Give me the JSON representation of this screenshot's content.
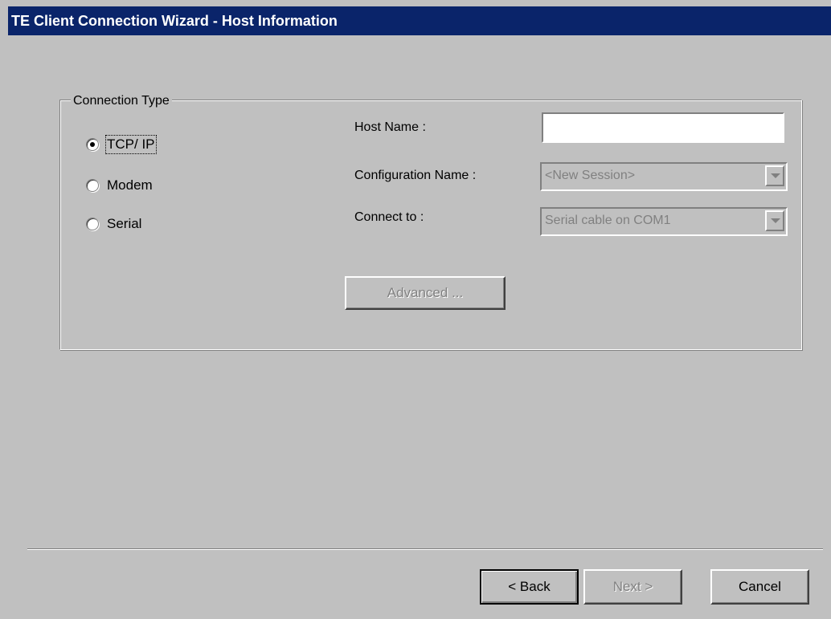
{
  "window": {
    "title": "TE Client Connection Wizard - Host Information"
  },
  "connection_type": {
    "legend": "Connection Type",
    "options": [
      {
        "label": "TCP/ IP",
        "selected": true
      },
      {
        "label": "Modem",
        "selected": false
      },
      {
        "label": "Serial",
        "selected": false
      }
    ]
  },
  "fields": {
    "host_name": {
      "label": "Host Name :",
      "value": ""
    },
    "configuration_name": {
      "label": "Configuration Name :",
      "value": "<New Session>",
      "enabled": false
    },
    "connect_to": {
      "label": "Connect to :",
      "value": "Serial cable on COM1",
      "enabled": false
    }
  },
  "buttons": {
    "advanced": "Advanced ...",
    "back": "< Back",
    "next": "Next >",
    "cancel": "Cancel"
  },
  "colors": {
    "titlebar": "#0a246a",
    "face": "#c0c0c0",
    "disabled_text": "#808080"
  }
}
